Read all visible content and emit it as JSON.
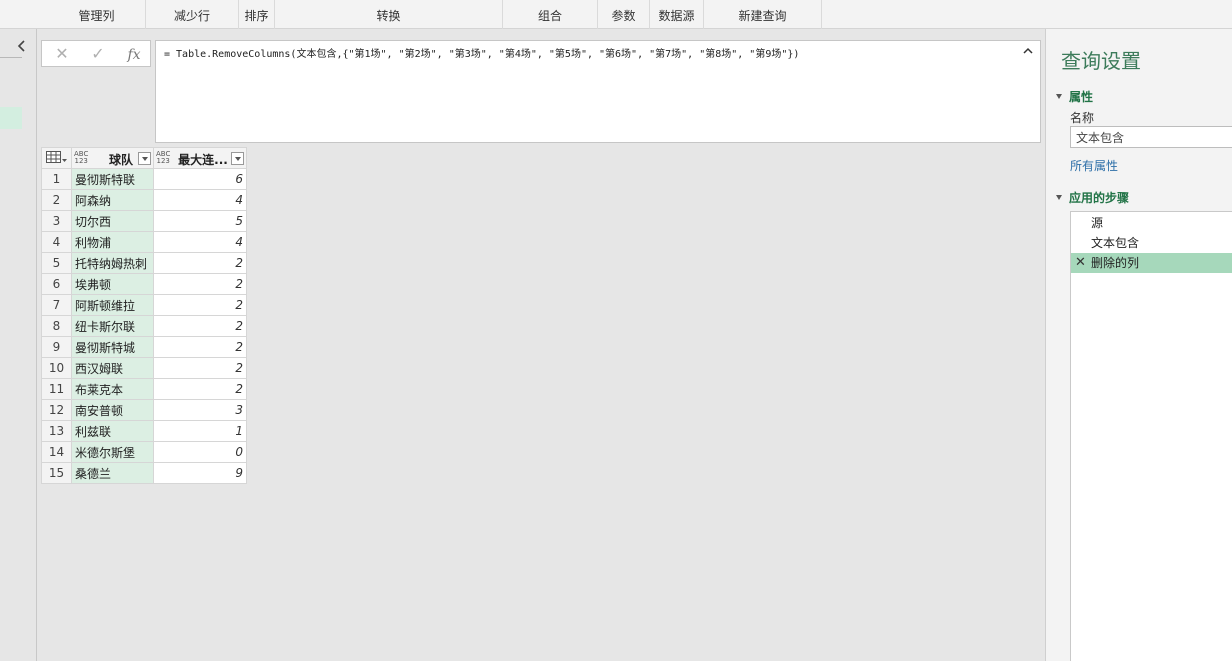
{
  "ribbon": {
    "groups": [
      "管理列",
      "减少行",
      "排序",
      "转换",
      "组合",
      "参数",
      "数据源",
      "新建查询"
    ]
  },
  "formula_bar": {
    "cancel_icon": "x-icon",
    "confirm_icon": "check-icon",
    "fx_label": "fx",
    "formula": "= Table.RemoveColumns(文本包含,{\"第1场\", \"第2场\", \"第3场\", \"第4场\", \"第5场\", \"第6场\", \"第7场\", \"第8场\", \"第9场\"})"
  },
  "grid": {
    "type_badge_top": "ABC",
    "type_badge_bottom": "123",
    "columns": [
      "球队",
      "最大连..."
    ],
    "rows": [
      {
        "num": "1",
        "team": "曼彻斯特联",
        "value": "6"
      },
      {
        "num": "2",
        "team": "阿森纳",
        "value": "4"
      },
      {
        "num": "3",
        "team": "切尔西",
        "value": "5"
      },
      {
        "num": "4",
        "team": "利物浦",
        "value": "4"
      },
      {
        "num": "5",
        "team": "托特纳姆热刺",
        "value": "2"
      },
      {
        "num": "6",
        "team": "埃弗顿",
        "value": "2"
      },
      {
        "num": "7",
        "team": "阿斯顿维拉",
        "value": "2"
      },
      {
        "num": "8",
        "team": "纽卡斯尔联",
        "value": "2"
      },
      {
        "num": "9",
        "team": "曼彻斯特城",
        "value": "2"
      },
      {
        "num": "10",
        "team": "西汉姆联",
        "value": "2"
      },
      {
        "num": "11",
        "team": "布莱克本",
        "value": "2"
      },
      {
        "num": "12",
        "team": "南安普顿",
        "value": "3"
      },
      {
        "num": "13",
        "team": "利兹联",
        "value": "1"
      },
      {
        "num": "14",
        "team": "米德尔斯堡",
        "value": "0"
      },
      {
        "num": "15",
        "team": "桑德兰",
        "value": "9"
      }
    ]
  },
  "query_settings": {
    "title": "查询设置",
    "properties_header": "属性",
    "name_label": "名称",
    "name_value": "文本包含",
    "all_properties_link": "所有属性",
    "steps_header": "应用的步骤",
    "steps": [
      "源",
      "文本包含",
      "删除的列"
    ],
    "selected_step": "删除的列"
  },
  "colors": {
    "selected_step_bg": "#a6d8bb",
    "team_column_bg": "#dcefe3",
    "accent_green": "#217346",
    "link_blue": "#2e6fa8"
  }
}
